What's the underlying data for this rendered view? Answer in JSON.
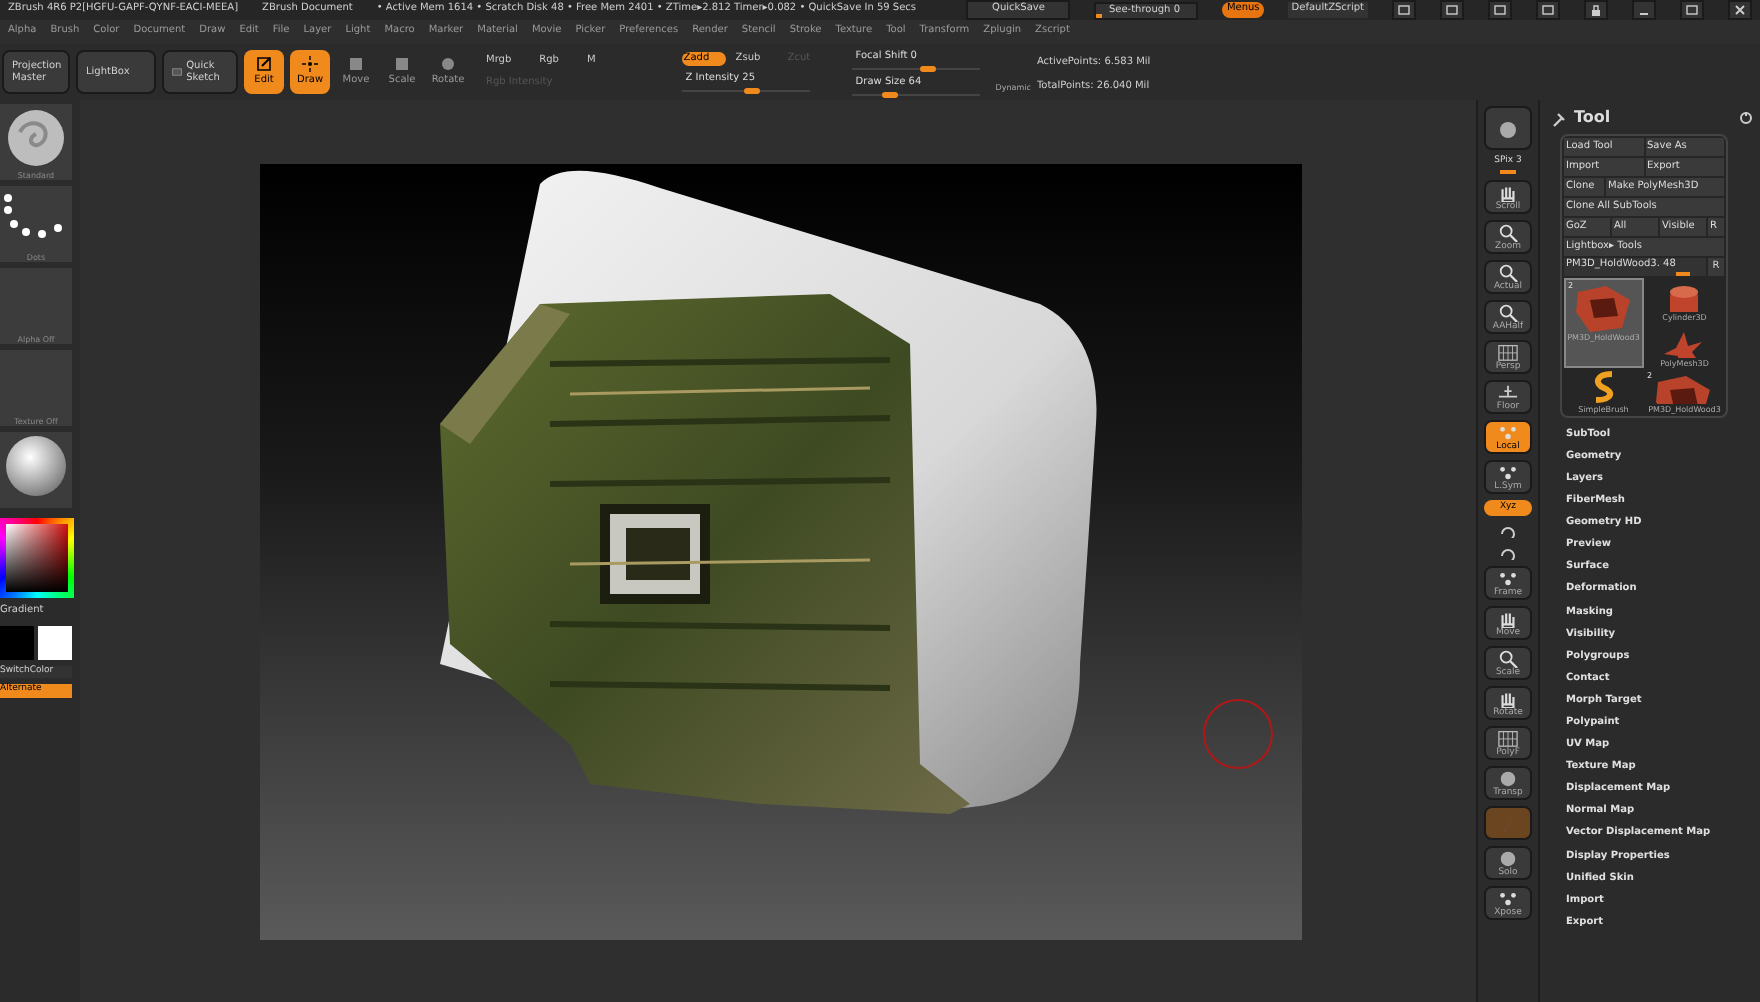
{
  "title_bar": {
    "app": "ZBrush 4R6 P2[HGFU-GAPF-QYNF-EACI-MEEA]",
    "document": "ZBrush Document",
    "stats": "• Active Mem 1614 • Scratch Disk 48 • Free Mem 2401 • ZTime▸2.812 Timer▸0.082 • QuickSave In 59 Secs"
  },
  "top_controls": {
    "quicksave": "QuickSave",
    "see_through": {
      "label": "See-through  0",
      "level": 0.05
    },
    "menus": {
      "label": "Menus",
      "selected": true
    },
    "script": "DefaultZScript"
  },
  "menu_bar": [
    "Alpha",
    "Brush",
    "Color",
    "Document",
    "Draw",
    "Edit",
    "File",
    "Layer",
    "Light",
    "Macro",
    "Marker",
    "Material",
    "Movie",
    "Picker",
    "Preferences",
    "Render",
    "Stencil",
    "Stroke",
    "Texture",
    "Tool",
    "Transform",
    "Zplugin",
    "Zscript"
  ],
  "shelf": {
    "buttons": [
      "Projection Master",
      "LightBox",
      "Quick Sketch"
    ],
    "modes": [
      {
        "label": "Edit",
        "on": true
      },
      {
        "label": "Draw",
        "on": true
      },
      {
        "label": "Move",
        "on": false
      },
      {
        "label": "Scale",
        "on": false
      },
      {
        "label": "Rotate",
        "on": false
      }
    ],
    "color_modes": [
      {
        "label": "Mrgb",
        "disabled": false
      },
      {
        "label": "Rgb",
        "disabled": false
      },
      {
        "label": "M",
        "disabled": false
      }
    ],
    "rgb_intensity": {
      "label": "Rgb Intensity",
      "disabled": true
    },
    "z_modes": [
      {
        "label": "Zadd",
        "on": true,
        "disabled": false
      },
      {
        "label": "Zsub",
        "on": false,
        "disabled": false
      },
      {
        "label": "Zcut",
        "on": false,
        "disabled": true
      }
    ],
    "z_intensity": {
      "label": "Z Intensity 25",
      "level": 0.55
    },
    "focal_shift": {
      "label": "Focal Shift 0",
      "level": 0.6
    },
    "draw_size": {
      "label": "Draw Size 64",
      "level": 0.3
    },
    "dynamic": "Dynamic",
    "active_points": "ActivePoints: 6.583 Mil",
    "total_points": "TotalPoints: 26.040 Mil"
  },
  "left_panel": {
    "thumbnails": [
      {
        "kind": "brush",
        "label": "Standard"
      },
      {
        "kind": "dots",
        "label": "Dots"
      },
      {
        "kind": "empty",
        "label": "Alpha Off"
      },
      {
        "kind": "empty",
        "label": "Texture Off"
      },
      {
        "kind": "sphere"
      }
    ],
    "gradient": "Gradient",
    "switch_color": "SwitchColor",
    "alternate": {
      "label": "Alternate",
      "on": true
    }
  },
  "right_toolbar": [
    {
      "kind": "sphere"
    },
    {
      "kind": "slider",
      "label": "SPix 3",
      "level": 0.5
    },
    {
      "kind": "hand",
      "label": "Scroll",
      "on": false
    },
    {
      "kind": "magnifier",
      "label": "Zoom",
      "on": false
    },
    {
      "kind": "magnifier",
      "label": "Actual",
      "on": false
    },
    {
      "kind": "magnifier",
      "label": "AAHalf",
      "on": false
    },
    {
      "kind": "grid",
      "label": "Persp",
      "on": false
    },
    {
      "kind": "floor",
      "label": "Floor",
      "on": false
    },
    {
      "kind": "dots",
      "label": "Local",
      "on": true
    },
    {
      "kind": "dots",
      "label": "L.Sym",
      "on": false
    },
    {
      "kind": "small",
      "label": "Xyz",
      "on": true
    },
    {
      "kind": "rotate"
    },
    {
      "kind": "rotate"
    },
    {
      "kind": "dots",
      "label": "Frame",
      "on": false
    },
    {
      "kind": "hand",
      "label": "Move",
      "on": false
    },
    {
      "kind": "magnifier",
      "label": "Scale",
      "on": false
    },
    {
      "kind": "hand",
      "label": "Rotate",
      "on": false
    },
    {
      "kind": "grid",
      "label": "PolyF",
      "on": false
    },
    {
      "kind": "sphere",
      "label": "Transp",
      "on": false
    },
    {
      "kind": "ghost"
    },
    {
      "kind": "sphere",
      "label": "Solo",
      "on": false
    },
    {
      "kind": "dots",
      "label": "Xpose",
      "on": false
    }
  ],
  "tool_panel": {
    "title": "Tool",
    "button_rows": [
      [
        "Load Tool",
        "Save As"
      ],
      [
        "Import",
        "Export"
      ],
      [
        "Clone",
        "Make PolyMesh3D"
      ],
      [
        "Clone All SubTools"
      ],
      [
        "GoZ",
        "All",
        "Visible",
        "R"
      ],
      [
        "Lightbox▸ Tools"
      ]
    ],
    "current_tool": {
      "label": "PM3D_HoldWood3. 48",
      "level": 0.85,
      "reset": "R"
    },
    "thumbnails": [
      {
        "kind": "mesh",
        "label": "PM3D_HoldWood3",
        "count": "2",
        "selected": true
      },
      {
        "kind": "cylinder",
        "label": "Cylinder3D",
        "selected": false
      },
      {
        "kind": "star",
        "label": "PolyMesh3D",
        "selected": false
      },
      {
        "kind": "brush",
        "label": "SimpleBrush",
        "selected": false
      },
      {
        "kind": "mesh",
        "label": "PM3D_HoldWood3",
        "count": "2",
        "selected": false
      }
    ],
    "menu": [
      "SubTool",
      "Geometry",
      "Layers",
      "FiberMesh",
      "Geometry HD",
      "Preview",
      "Surface",
      "Deformation",
      "Masking",
      "Visibility",
      "Polygroups",
      "Contact",
      "Morph Target",
      "Polypaint",
      "UV Map",
      "Texture Map",
      "Displacement Map",
      "Normal Map",
      "Vector Displacement Map",
      "Display Properties",
      "Unified Skin",
      "Import",
      "Export"
    ]
  }
}
